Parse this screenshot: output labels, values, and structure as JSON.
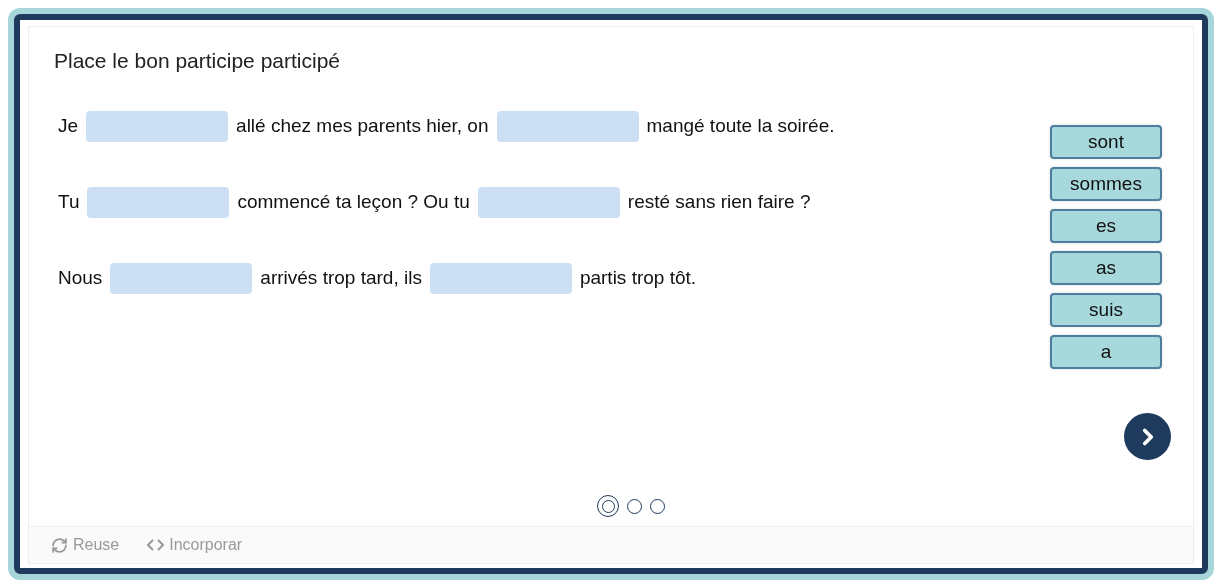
{
  "title": "Place le bon participe participé",
  "sentences": [
    {
      "segments": [
        {
          "kind": "text",
          "text": "Je"
        },
        {
          "kind": "blank"
        },
        {
          "kind": "text",
          "text": "allé chez mes parents hier, on"
        },
        {
          "kind": "blank"
        },
        {
          "kind": "text",
          "text": "mangé toute la soirée."
        }
      ]
    },
    {
      "segments": [
        {
          "kind": "text",
          "text": "Tu"
        },
        {
          "kind": "blank"
        },
        {
          "kind": "text",
          "text": "commencé ta leçon ? Ou tu"
        },
        {
          "kind": "blank"
        },
        {
          "kind": "text",
          "text": "resté sans rien faire ?"
        }
      ]
    },
    {
      "segments": [
        {
          "kind": "text",
          "text": "Nous"
        },
        {
          "kind": "blank"
        },
        {
          "kind": "text",
          "text": "arrivés trop tard, ils"
        },
        {
          "kind": "blank"
        },
        {
          "kind": "text",
          "text": "partis trop tôt."
        }
      ]
    }
  ],
  "words": [
    "sont",
    "sommes",
    "es",
    "as",
    "suis",
    "a"
  ],
  "pages": [
    {
      "selected": true
    },
    {
      "selected": false
    },
    {
      "selected": false
    }
  ],
  "footer": [
    {
      "kind": "reuse",
      "label": "Reuse"
    },
    {
      "kind": "embed",
      "label": "Incorporar"
    }
  ]
}
